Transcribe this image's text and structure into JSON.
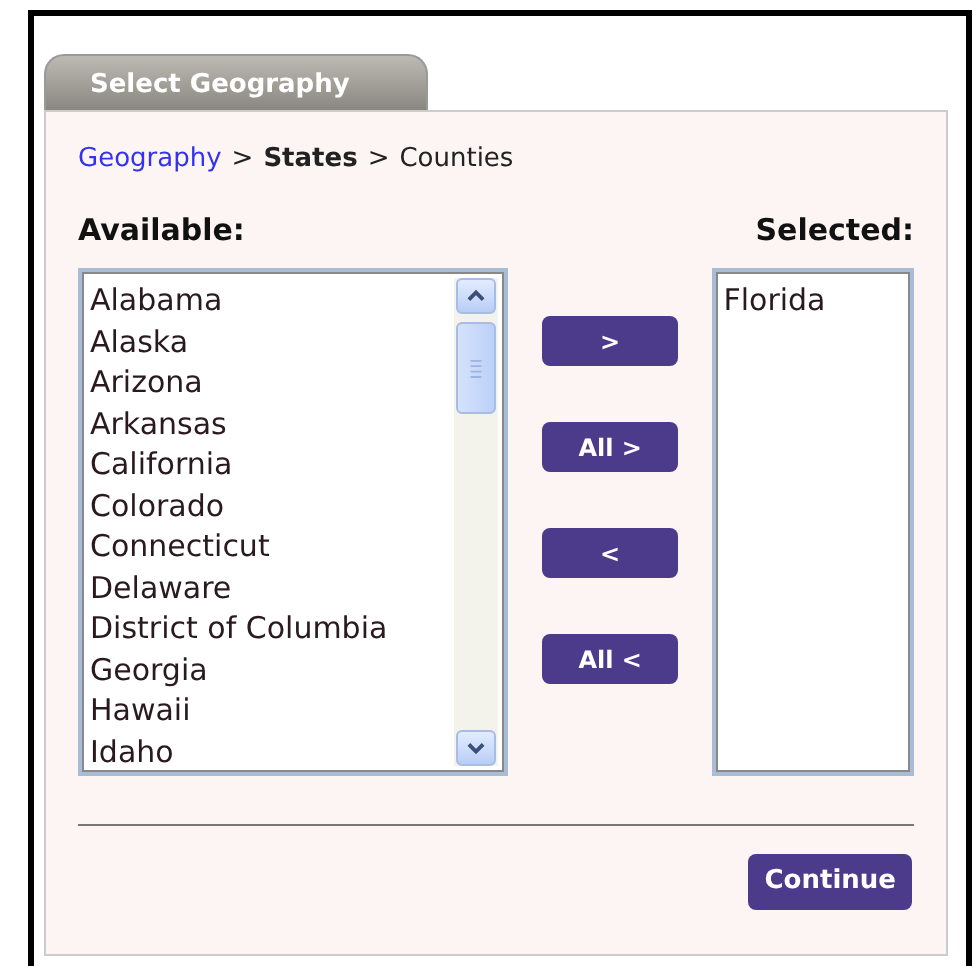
{
  "tab": {
    "label": "Select Geography"
  },
  "breadcrumb": [
    {
      "text": "Geography",
      "kind": "link"
    },
    {
      "text": ">",
      "kind": "separator"
    },
    {
      "text": "States",
      "kind": "current"
    },
    {
      "text": ">",
      "kind": "separator"
    },
    {
      "text": "Counties",
      "kind": "plain"
    }
  ],
  "available": {
    "label": "Available:",
    "items": [
      "Alabama",
      "Alaska",
      "Arizona",
      "Arkansas",
      "California",
      "Colorado",
      "Connecticut",
      "Delaware",
      "District of Columbia",
      "Georgia",
      "Hawaii",
      "Idaho"
    ]
  },
  "move_buttons": [
    ">",
    "All >",
    "<",
    "All <"
  ],
  "selected": {
    "label": "Selected:",
    "items": [
      "Florida"
    ]
  },
  "continue_button": "Continue"
}
